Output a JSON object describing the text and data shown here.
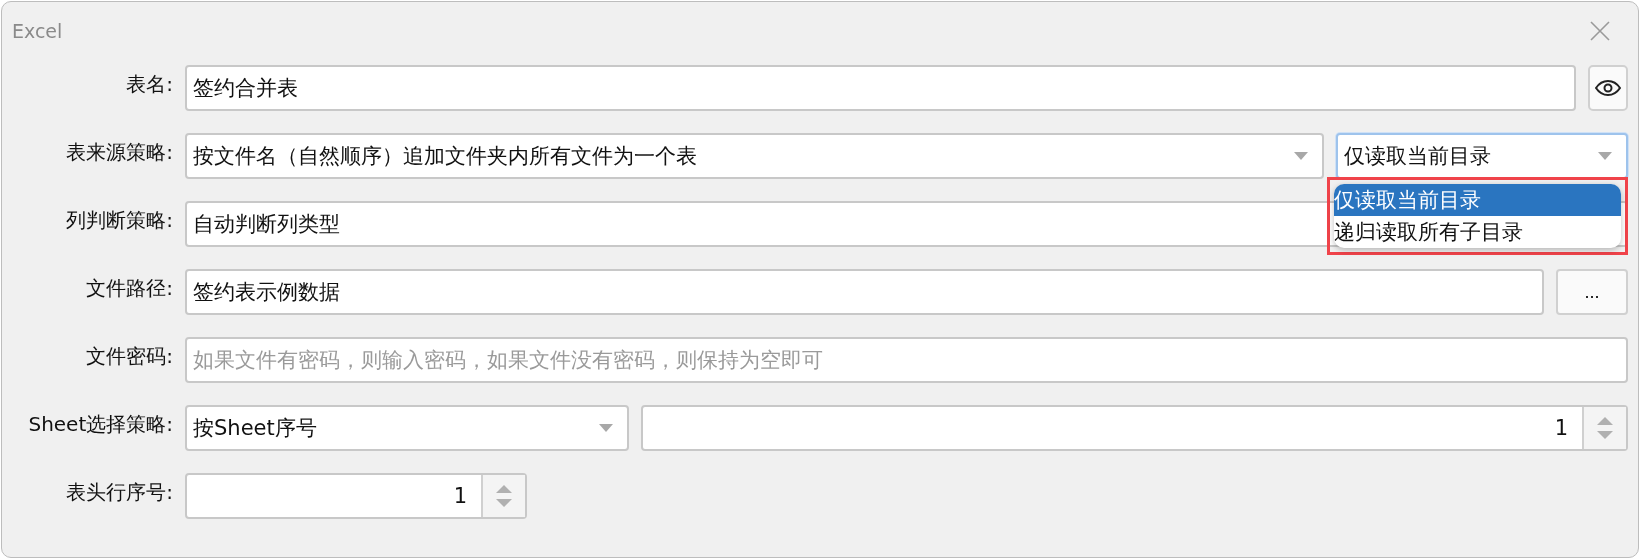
{
  "window": {
    "title": "Excel"
  },
  "rows": [
    {
      "kind": "text",
      "label": "表名:",
      "value": "签约合并表"
    },
    {
      "kind": "combo_pair",
      "label": "表来源策略:",
      "value": "按文件名（自然顺序）追加文件夹内所有文件为一个表",
      "second": {
        "value": "仅读取当前目录",
        "expanded": true,
        "highlighted": true,
        "options": [
          {
            "label": "仅读取当前目录",
            "selected": true
          },
          {
            "label": "递归读取所有子目录",
            "selected": false
          }
        ]
      }
    },
    {
      "kind": "combo",
      "label": "列判断策略:",
      "value": "自动判断列类型"
    },
    {
      "kind": "path",
      "label": "文件路径:",
      "value": "签约表示例数据",
      "button": "..."
    },
    {
      "kind": "password",
      "label": "文件密码:",
      "placeholder": "如果文件有密码，则输入密码，如果文件没有密码，则保持为空即可"
    },
    {
      "kind": "combo_spin",
      "label": "Sheet选择策略:",
      "value": "按Sheet序号",
      "number": "1"
    },
    {
      "kind": "spin",
      "label": "表头行序号:",
      "number": "1"
    }
  ]
}
